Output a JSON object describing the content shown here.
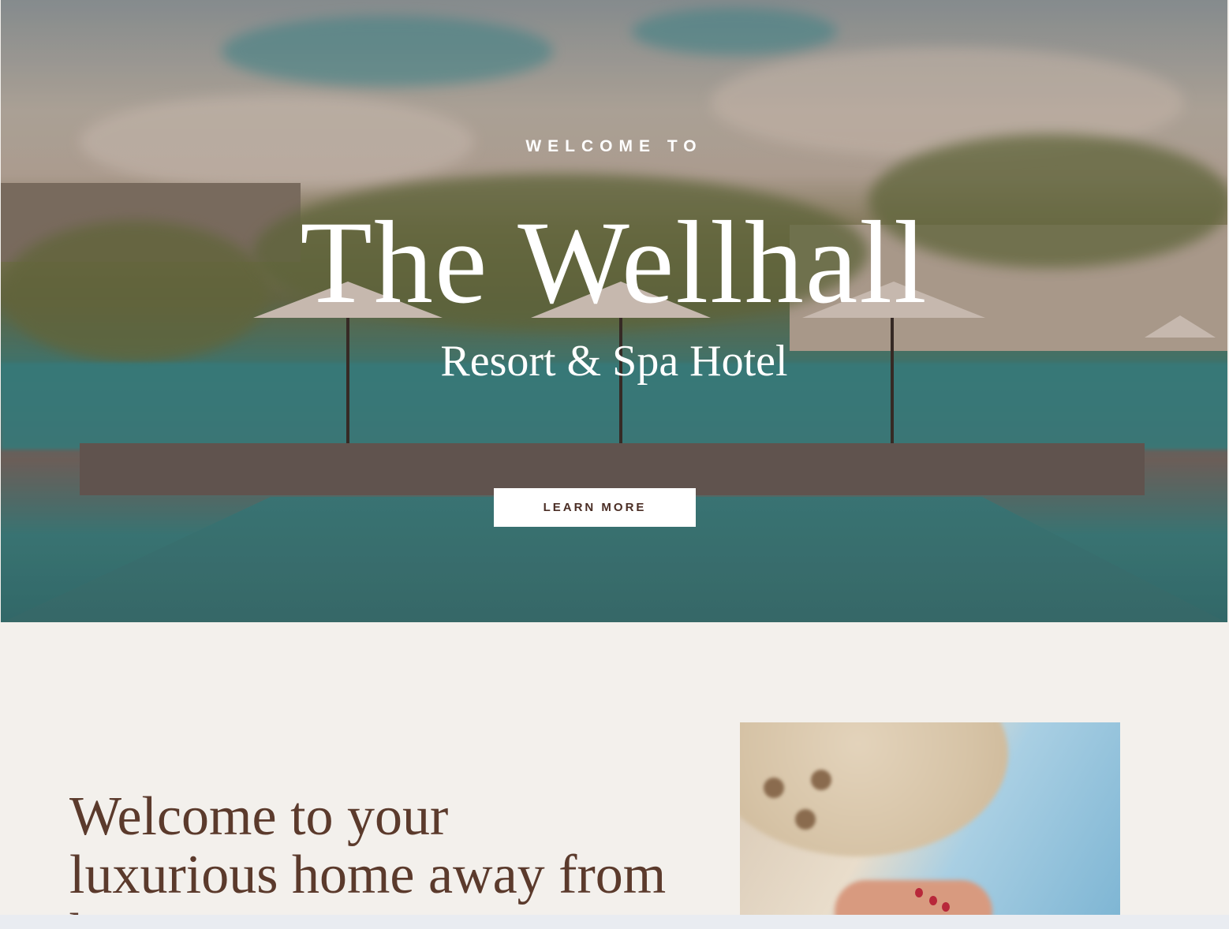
{
  "hero": {
    "eyebrow": "WELCOME TO",
    "title": "The Wellhall",
    "subtitle": "Resort & Spa Hotel",
    "cta_label": "LEARN MORE"
  },
  "intro": {
    "heading": "Welcome to your luxurious home away from home"
  },
  "colors": {
    "heading_brown": "#5b3a2c",
    "button_text": "#4a2d24",
    "section_background": "#f3f0ec"
  }
}
